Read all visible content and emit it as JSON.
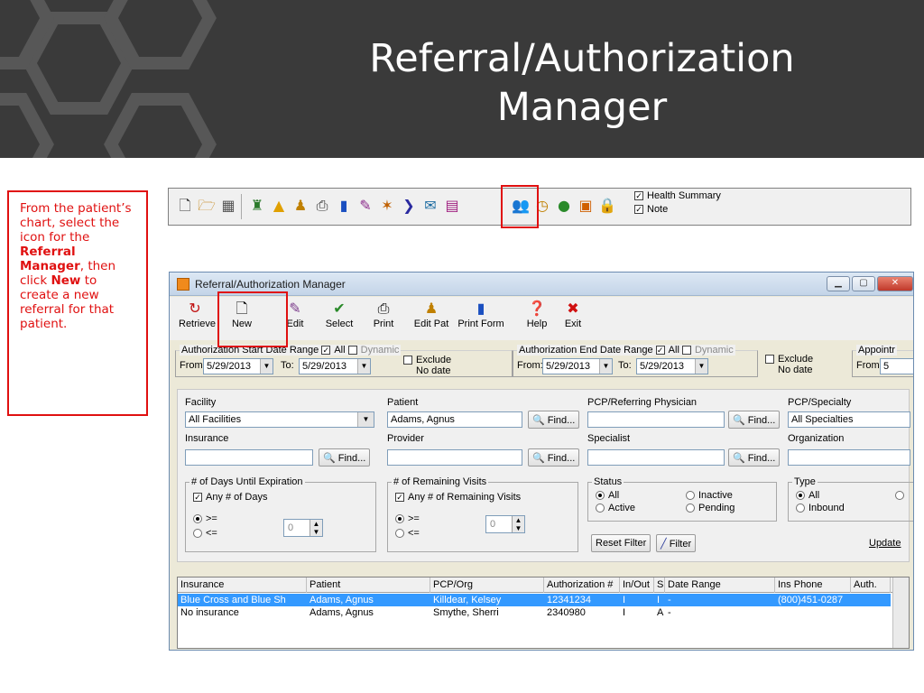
{
  "slide": {
    "title_line1": "Referral/Authorization",
    "title_line2": "Manager",
    "callout": {
      "t1": "From the patient’s chart, select the icon for the ",
      "b1": "Referral Manager",
      "t2": ", then click ",
      "b2": "New",
      "t3": " to create a new referral for that patient."
    }
  },
  "chart_toolbar": {
    "icons": [
      "new-doc-icon",
      "open-folder-icon",
      "trash-icon",
      "lab-icon",
      "warning-icon",
      "person-icon",
      "print-icon",
      "document-icon",
      "pencil-icon",
      "wand-icon",
      "arrow-icon",
      "mail-icon",
      "chart-icon",
      "referral-people-icon",
      "clock-icon",
      "globe-icon",
      "calculator-icon",
      "lock-icon"
    ],
    "health_summary": "Health Summary",
    "note": "Note"
  },
  "window": {
    "title": "Referral/Authorization Manager",
    "toolbar": [
      {
        "label": "Retrieve",
        "icon": "retrieve-icon"
      },
      {
        "label": "New",
        "icon": "new-doc-icon"
      },
      {
        "label": "Edit",
        "icon": "pencil-icon"
      },
      {
        "label": "Select",
        "icon": "checkmark-icon"
      },
      {
        "label": "Print",
        "icon": "print-icon"
      },
      {
        "label": "Edit Pat",
        "icon": "person-icon"
      },
      {
        "label": "Print Form",
        "icon": "document-icon"
      },
      {
        "label": "Help",
        "icon": "help-icon"
      },
      {
        "label": "Exit",
        "icon": "close-icon"
      }
    ],
    "auth_start": {
      "label": "Authorization Start Date Range",
      "all": "All",
      "dynamic": "Dynamic",
      "from_label": "From:",
      "from": "5/29/2013",
      "to_label": "To:",
      "to": "5/29/2013",
      "exclude": "Exclude",
      "no_date": "No date"
    },
    "auth_end": {
      "label": "Authorization End Date Range",
      "all": "All",
      "dynamic": "Dynamic",
      "from_label": "From:",
      "from": "5/29/2013",
      "to_label": "To:",
      "to": "5/29/2013",
      "exclude": "Exclude",
      "no_date": "No date"
    },
    "appointment": {
      "label": "Appointr",
      "from_label": "From:",
      "from": "5"
    },
    "filters": {
      "facility_label": "Facility",
      "facility_value": "All Facilities",
      "patient_label": "Patient",
      "patient_value": "Adams, Agnus",
      "pcp_label": "PCP/Referring Physician",
      "pcp_value": "",
      "specialty_label": "PCP/Specialty",
      "specialty_value": "All Specialties",
      "insurance_label": "Insurance",
      "provider_label": "Provider",
      "specialist_label": "Specialist",
      "organization_label": "Organization",
      "find": "Find...",
      "days_group": "# of Days Until Expiration",
      "days_any": "Any # of Days",
      "gte": ">=",
      "lte": "<=",
      "days_value": "0",
      "visits_group": "# of Remaining Visits",
      "visits_any": "Any # of Remaining Visits",
      "visits_value": "0",
      "status_group": "Status",
      "status_all": "All",
      "status_active": "Active",
      "status_inactive": "Inactive",
      "status_pending": "Pending",
      "type_group": "Type",
      "type_all": "All",
      "type_inbound": "Inbound",
      "reset_filter": "Reset Filter",
      "filter": "Filter",
      "update": "Update"
    },
    "grid": {
      "columns": [
        "Insurance",
        "Patient",
        "PCP/Org",
        "Authorization #",
        "In/Out",
        "S",
        "Date Range",
        "Ins Phone",
        "Auth."
      ],
      "rows": [
        [
          "Blue Cross and Blue Sh",
          "Adams, Agnus",
          "Killdear, Kelsey",
          "12341234",
          "I",
          "I",
          "-",
          "(800)451-0287",
          ""
        ],
        [
          "No insurance",
          "Adams, Agnus",
          "Smythe, Sherri",
          "2340980",
          "I",
          "A",
          "-",
          "",
          ""
        ]
      ]
    }
  },
  "colors": {
    "highlight": "#e01010",
    "banner": "#3a3a3a",
    "selected_row": "#3399ff"
  }
}
